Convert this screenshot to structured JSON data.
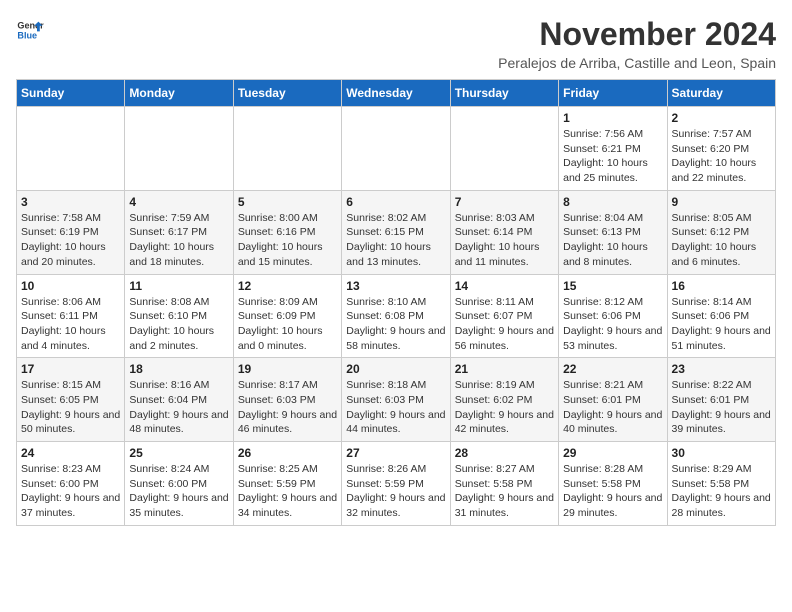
{
  "logo": {
    "general": "General",
    "blue": "Blue"
  },
  "header": {
    "month_title": "November 2024",
    "subtitle": "Peralejos de Arriba, Castille and Leon, Spain"
  },
  "days_of_week": [
    "Sunday",
    "Monday",
    "Tuesday",
    "Wednesday",
    "Thursday",
    "Friday",
    "Saturday"
  ],
  "weeks": [
    {
      "days": [
        {
          "num": "",
          "info": ""
        },
        {
          "num": "",
          "info": ""
        },
        {
          "num": "",
          "info": ""
        },
        {
          "num": "",
          "info": ""
        },
        {
          "num": "",
          "info": ""
        },
        {
          "num": "1",
          "info": "Sunrise: 7:56 AM\nSunset: 6:21 PM\nDaylight: 10 hours and 25 minutes."
        },
        {
          "num": "2",
          "info": "Sunrise: 7:57 AM\nSunset: 6:20 PM\nDaylight: 10 hours and 22 minutes."
        }
      ]
    },
    {
      "days": [
        {
          "num": "3",
          "info": "Sunrise: 7:58 AM\nSunset: 6:19 PM\nDaylight: 10 hours and 20 minutes."
        },
        {
          "num": "4",
          "info": "Sunrise: 7:59 AM\nSunset: 6:17 PM\nDaylight: 10 hours and 18 minutes."
        },
        {
          "num": "5",
          "info": "Sunrise: 8:00 AM\nSunset: 6:16 PM\nDaylight: 10 hours and 15 minutes."
        },
        {
          "num": "6",
          "info": "Sunrise: 8:02 AM\nSunset: 6:15 PM\nDaylight: 10 hours and 13 minutes."
        },
        {
          "num": "7",
          "info": "Sunrise: 8:03 AM\nSunset: 6:14 PM\nDaylight: 10 hours and 11 minutes."
        },
        {
          "num": "8",
          "info": "Sunrise: 8:04 AM\nSunset: 6:13 PM\nDaylight: 10 hours and 8 minutes."
        },
        {
          "num": "9",
          "info": "Sunrise: 8:05 AM\nSunset: 6:12 PM\nDaylight: 10 hours and 6 minutes."
        }
      ]
    },
    {
      "days": [
        {
          "num": "10",
          "info": "Sunrise: 8:06 AM\nSunset: 6:11 PM\nDaylight: 10 hours and 4 minutes."
        },
        {
          "num": "11",
          "info": "Sunrise: 8:08 AM\nSunset: 6:10 PM\nDaylight: 10 hours and 2 minutes."
        },
        {
          "num": "12",
          "info": "Sunrise: 8:09 AM\nSunset: 6:09 PM\nDaylight: 10 hours and 0 minutes."
        },
        {
          "num": "13",
          "info": "Sunrise: 8:10 AM\nSunset: 6:08 PM\nDaylight: 9 hours and 58 minutes."
        },
        {
          "num": "14",
          "info": "Sunrise: 8:11 AM\nSunset: 6:07 PM\nDaylight: 9 hours and 56 minutes."
        },
        {
          "num": "15",
          "info": "Sunrise: 8:12 AM\nSunset: 6:06 PM\nDaylight: 9 hours and 53 minutes."
        },
        {
          "num": "16",
          "info": "Sunrise: 8:14 AM\nSunset: 6:06 PM\nDaylight: 9 hours and 51 minutes."
        }
      ]
    },
    {
      "days": [
        {
          "num": "17",
          "info": "Sunrise: 8:15 AM\nSunset: 6:05 PM\nDaylight: 9 hours and 50 minutes."
        },
        {
          "num": "18",
          "info": "Sunrise: 8:16 AM\nSunset: 6:04 PM\nDaylight: 9 hours and 48 minutes."
        },
        {
          "num": "19",
          "info": "Sunrise: 8:17 AM\nSunset: 6:03 PM\nDaylight: 9 hours and 46 minutes."
        },
        {
          "num": "20",
          "info": "Sunrise: 8:18 AM\nSunset: 6:03 PM\nDaylight: 9 hours and 44 minutes."
        },
        {
          "num": "21",
          "info": "Sunrise: 8:19 AM\nSunset: 6:02 PM\nDaylight: 9 hours and 42 minutes."
        },
        {
          "num": "22",
          "info": "Sunrise: 8:21 AM\nSunset: 6:01 PM\nDaylight: 9 hours and 40 minutes."
        },
        {
          "num": "23",
          "info": "Sunrise: 8:22 AM\nSunset: 6:01 PM\nDaylight: 9 hours and 39 minutes."
        }
      ]
    },
    {
      "days": [
        {
          "num": "24",
          "info": "Sunrise: 8:23 AM\nSunset: 6:00 PM\nDaylight: 9 hours and 37 minutes."
        },
        {
          "num": "25",
          "info": "Sunrise: 8:24 AM\nSunset: 6:00 PM\nDaylight: 9 hours and 35 minutes."
        },
        {
          "num": "26",
          "info": "Sunrise: 8:25 AM\nSunset: 5:59 PM\nDaylight: 9 hours and 34 minutes."
        },
        {
          "num": "27",
          "info": "Sunrise: 8:26 AM\nSunset: 5:59 PM\nDaylight: 9 hours and 32 minutes."
        },
        {
          "num": "28",
          "info": "Sunrise: 8:27 AM\nSunset: 5:58 PM\nDaylight: 9 hours and 31 minutes."
        },
        {
          "num": "29",
          "info": "Sunrise: 8:28 AM\nSunset: 5:58 PM\nDaylight: 9 hours and 29 minutes."
        },
        {
          "num": "30",
          "info": "Sunrise: 8:29 AM\nSunset: 5:58 PM\nDaylight: 9 hours and 28 minutes."
        }
      ]
    }
  ]
}
